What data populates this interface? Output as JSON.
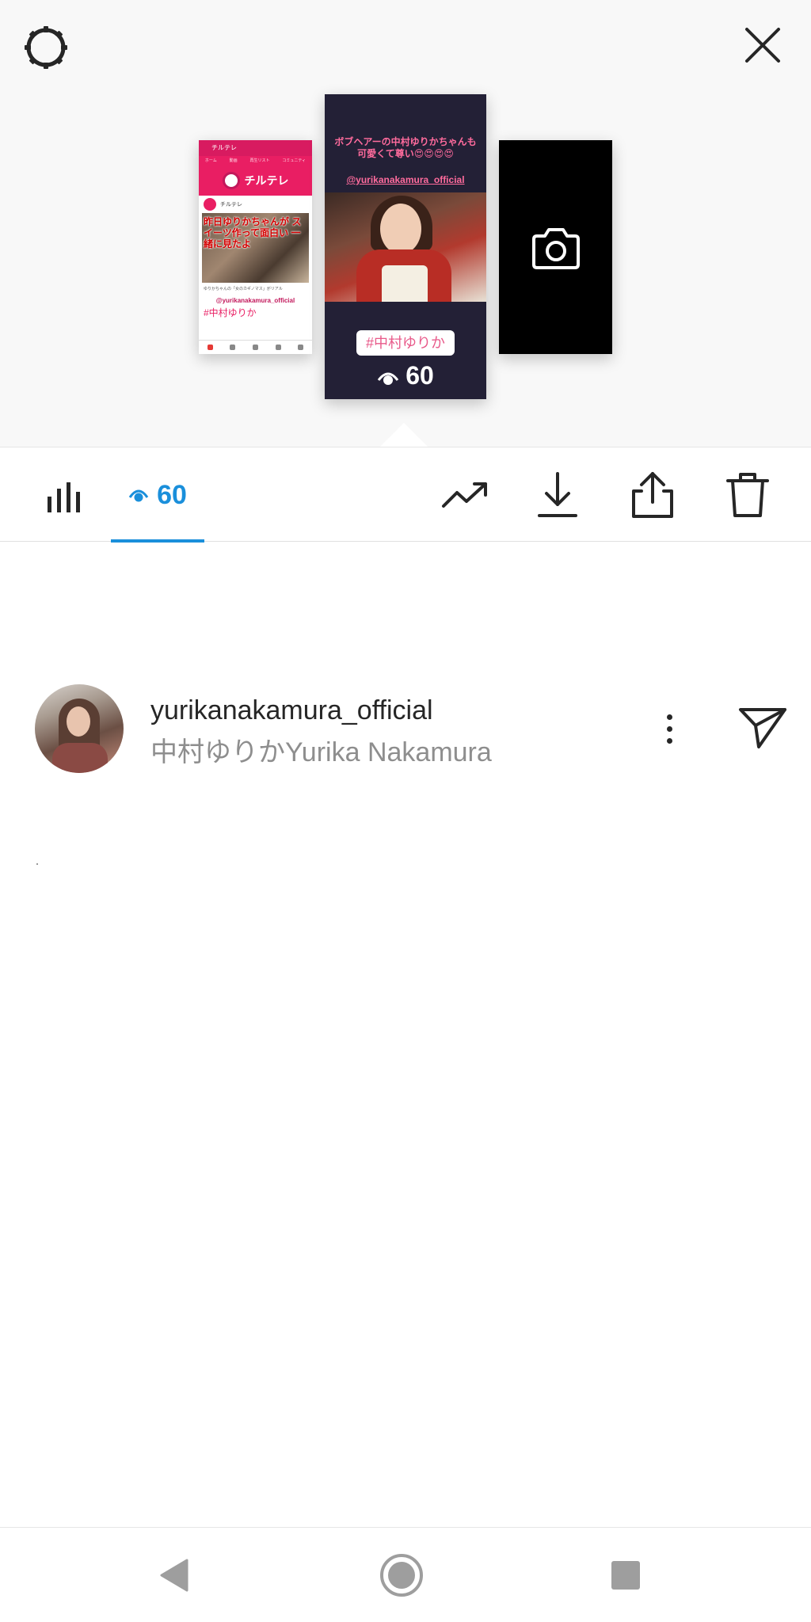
{
  "colors": {
    "accent": "#1a8fdb",
    "story_background": "#232036",
    "story_text": "#ff6b9d",
    "brand_pink": "#e91e63",
    "text_primary": "#262626",
    "text_secondary": "#8e8e8e"
  },
  "header": {
    "settings_icon": "gear-icon",
    "close_icon": "close-icon"
  },
  "stories": {
    "left": {
      "app_bar_title": "チルテレ",
      "tabs": [
        "ホーム",
        "動画",
        "再生リスト",
        "コミュニティ"
      ],
      "banner_title": "チルテレ",
      "channel_name": "チルテレ",
      "overlay_text": "昨日ゆりかちゃんが スイーツ作って面白い 一緒に見たよ",
      "caption": "ゆりかちゃんの「女のカギノマス」がリアル",
      "handle": "@yurikanakamura_official",
      "hashtag": "#中村ゆりか"
    },
    "center": {
      "caption": "ボブヘアーの中村ゆりかちゃんも可愛くて尊い😍😍😍😍",
      "handle": "@yurikanakamura_official",
      "hashtag": "#中村ゆりか",
      "view_count": "60"
    },
    "right": {
      "icon": "camera-icon"
    }
  },
  "toolbar": {
    "insights_icon": "bar-chart-icon",
    "viewer_count": "60",
    "promote_icon": "trending-up-icon",
    "save_icon": "download-icon",
    "share_icon": "share-icon",
    "delete_icon": "trash-icon"
  },
  "viewers": [
    {
      "username": "yurikanakamura_official",
      "full_name": "中村ゆりかYurika Nakamura"
    }
  ],
  "navbar": {
    "back_icon": "back-triangle-icon",
    "home_icon": "home-circle-icon",
    "recents_icon": "recents-square-icon"
  }
}
